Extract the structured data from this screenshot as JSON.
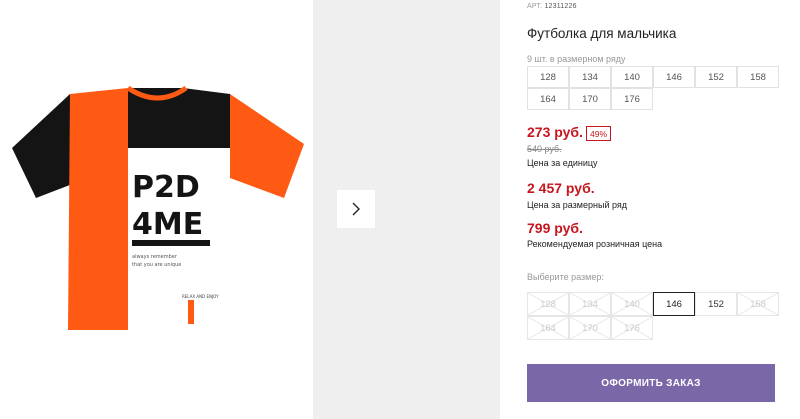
{
  "product": {
    "sku_label": "АРТ.",
    "sku_value": "12311226",
    "title": "Футболка для мальчика",
    "print_text": {
      "line1": "P2D",
      "line2": "4ME",
      "small1": "always remember",
      "small2": "that you are unique",
      "tag": "RELAX AND ENJOY"
    }
  },
  "size_row": {
    "note": "9 шт. в размерном ряду",
    "sizes": [
      "128",
      "134",
      "140",
      "146",
      "152",
      "158",
      "164",
      "170",
      "176"
    ]
  },
  "pricing": {
    "unit_price": "273 руб.",
    "discount": "49%",
    "old_price": "540 руб.",
    "unit_label": "Цена за единицу",
    "row_price": "2 457 руб.",
    "row_label": "Цена за размерный ряд",
    "retail_price": "799 руб.",
    "retail_label": "Рекомендуемая розничная цена"
  },
  "size_select": {
    "label": "Выберите размер:",
    "options": [
      {
        "size": "128",
        "state": "unavailable"
      },
      {
        "size": "134",
        "state": "unavailable"
      },
      {
        "size": "140",
        "state": "unavailable"
      },
      {
        "size": "146",
        "state": "selected"
      },
      {
        "size": "152",
        "state": "available"
      },
      {
        "size": "158",
        "state": "unavailable"
      },
      {
        "size": "164",
        "state": "unavailable"
      },
      {
        "size": "170",
        "state": "unavailable"
      },
      {
        "size": "176",
        "state": "unavailable"
      }
    ]
  },
  "order_button": "ОФОРМИТЬ ЗАКАЗ",
  "colors": {
    "price_red": "#c7161d",
    "button_purple": "#7a67a8",
    "tshirt_orange": "#ff5a14",
    "tshirt_black": "#141414"
  },
  "icons": {
    "next": "chevron-right-icon"
  }
}
